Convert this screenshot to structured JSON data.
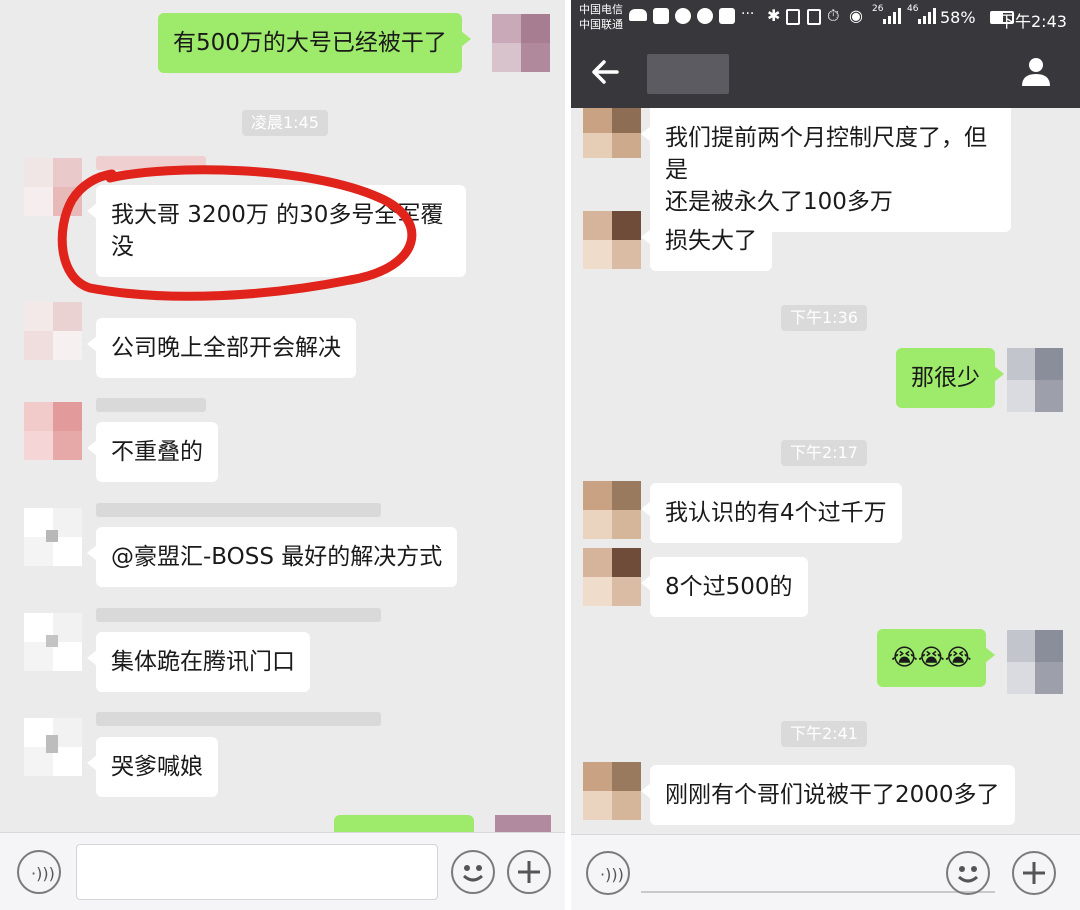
{
  "left": {
    "messages": {
      "top_out": "有500万的大号已经被干了",
      "ts1": "凌晨1:45",
      "m1": "我大哥 3200万 的30多号全军覆\n没",
      "m2": "公司晚上全部开会解决",
      "m3": "不重叠的",
      "m4": "@豪盟汇-BOSS 最好的解决方式",
      "m5": "集体跪在腾讯门口",
      "m6": "哭爹喊娘"
    },
    "input": {
      "voice_icon": "voice-wave-icon",
      "emoji_icon": "smiley-icon",
      "plus_icon": "plus-icon"
    }
  },
  "right": {
    "status": {
      "carrier1": "中国电信",
      "carrier2": "中国联通",
      "signal1": "26",
      "signal2": "46",
      "battery": "58%",
      "time": "下午2:43"
    },
    "nav": {
      "back_icon": "back-arrow-icon",
      "profile_icon": "person-icon"
    },
    "messages": {
      "m1": "我们提前两个月控制尺度了，但是\n还是被永久了100多万",
      "m2": "损失大了",
      "ts1": "下午1:36",
      "o1": "那很少",
      "ts2": "下午2:17",
      "m3": "我认识的有4个过千万",
      "m4": "8个过500的",
      "o2": "😭😭😭",
      "ts3": "下午2:41",
      "m5": "刚刚有个哥们说被干了2000多了"
    }
  },
  "colors": {
    "chat_bg": "#ebebeb",
    "bubble_out": "#9eea6a",
    "bubble_in": "#ffffff",
    "header": "#38383c",
    "highlight_ring": "#e0231b"
  }
}
